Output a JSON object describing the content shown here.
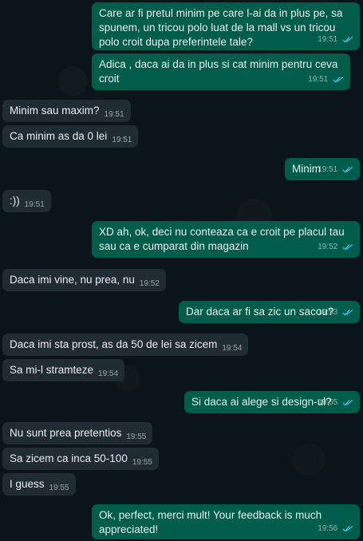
{
  "chat": {
    "messages": [
      {
        "dir": "out",
        "text": "Care ar fi pretul minim pe care l-ai da in plus pe, sa spunem, un tricou polo luat de la mall vs un tricou polo croit dupa preferintele tale?",
        "time": "19:51"
      },
      {
        "dir": "out",
        "text": "Adica , daca ai da in plus si cat minim pentru ceva croit",
        "time": "19:51"
      },
      {
        "dir": "in",
        "text": "Minim sau maxim?",
        "time": "19:51"
      },
      {
        "dir": "in",
        "text": "Ca minim as da 0 lei",
        "time": "19:51"
      },
      {
        "dir": "out",
        "text": "Minim",
        "time": "19:51"
      },
      {
        "dir": "in",
        "text": ":))",
        "time": "19:51"
      },
      {
        "dir": "out",
        "text": "XD ah, ok, deci nu conteaza ca e croit pe placul tau sau ca e cumparat din magazin",
        "time": "19:52"
      },
      {
        "dir": "in",
        "text": "Daca imi vine, nu prea, nu",
        "time": "19:52"
      },
      {
        "dir": "out",
        "text": "Dar daca ar fi sa zic un sacou?",
        "time": "19:53"
      },
      {
        "dir": "in",
        "text": "Daca imi sta prost, as da 50 de lei sa zicem",
        "time": "19:54"
      },
      {
        "dir": "in",
        "text": "Sa mi-l stramteze",
        "time": "19:54"
      },
      {
        "dir": "out",
        "text": "Si daca ai alege si design-ul?",
        "time": "19:55"
      },
      {
        "dir": "in",
        "text": "Nu sunt prea pretentios",
        "time": "19:55"
      },
      {
        "dir": "in",
        "text": "Sa zicem ca inca 50-100",
        "time": "19:55"
      },
      {
        "dir": "in",
        "text": "I guess",
        "time": "19:55"
      },
      {
        "dir": "out",
        "text": "Ok, perfect, merci mult! Your feedback is much appreciated!",
        "time": "19:56"
      }
    ]
  },
  "colors": {
    "background": "#0b141a",
    "outgoing_bubble": "#005c4b",
    "incoming_bubble": "#202c33",
    "read_ticks": "#53bdeb"
  },
  "icons": {
    "read_status": "double-check-icon"
  }
}
